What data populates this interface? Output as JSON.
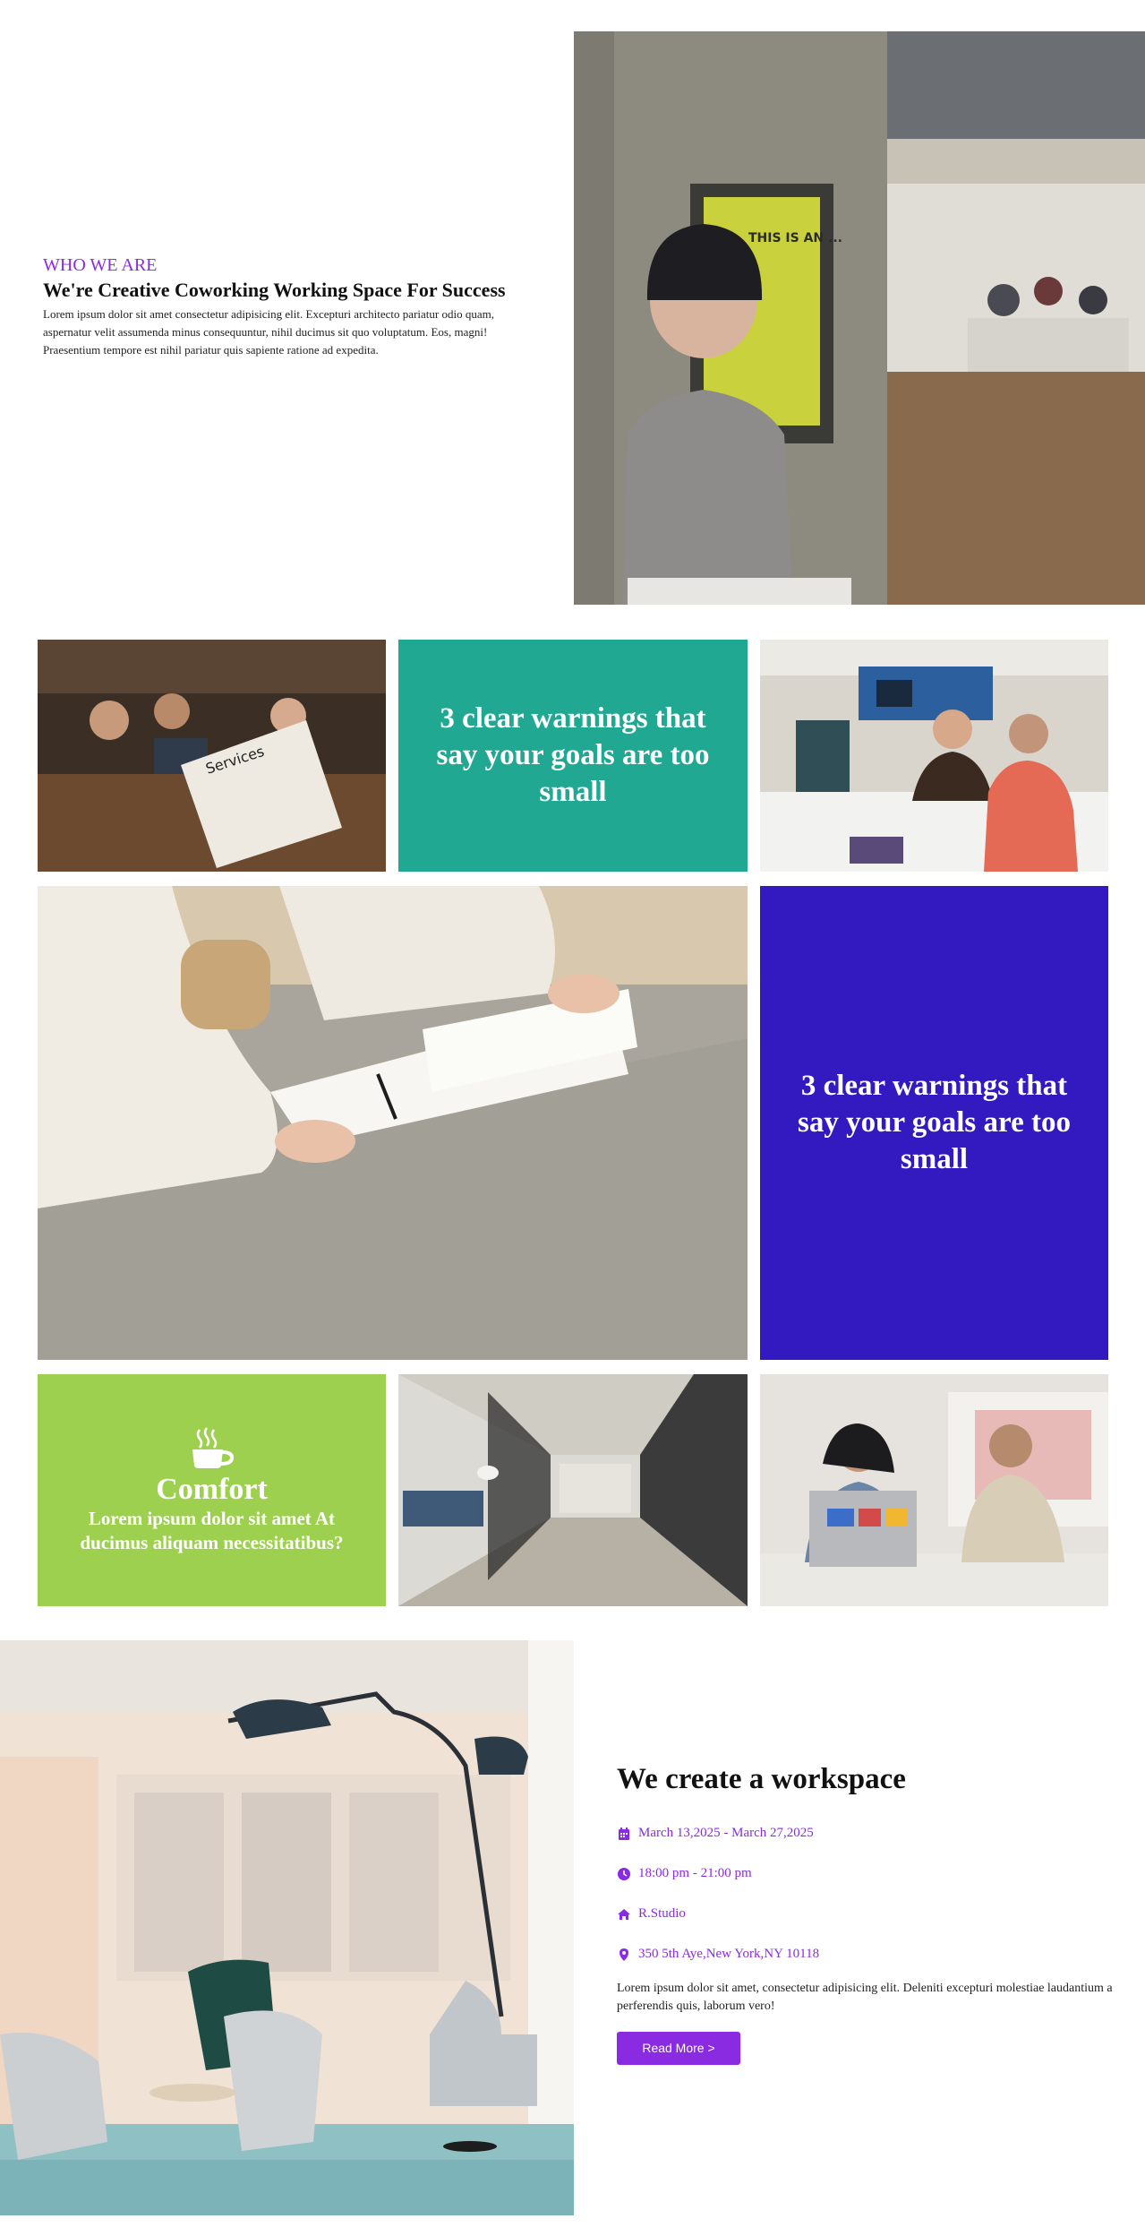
{
  "about": {
    "eyebrow": "WHO WE ARE",
    "title": "We're Creative Coworking Working Space For Success",
    "body": "Lorem ipsum dolor sit amet consectetur adipisicing elit. Excepturi architecto pariatur odio quam, aspernatur velit assumenda minus consequuntur, nihil ducimus sit quo voluptatum. Eos, magni! Praesentium tempore est nihil pariatur quis sapiente ratione ad expedita.",
    "poster_text": "THIS IS AN ..."
  },
  "grid": {
    "warning_teal": "3 clear warnings that say your goals are too small",
    "warning_blue": "3 clear warnings that say your goals are too small",
    "comfort_title": "Comfort",
    "comfort_sub": "Lorem ipsum dolor sit amet At ducimus aliquam necessitatibus?",
    "book_text": "Services"
  },
  "workspace": {
    "title": "We create a workspace",
    "date": "March 13,2025 - March 27,2025",
    "time": "18:00 pm - 21:00 pm",
    "venue": "R.Studio",
    "address": "350 5th Aye,New York,NY 10118",
    "body": "Lorem ipsum dolor sit amet, consectetur adipisicing elit. Deleniti excepturi molestiae laudantium a perferendis quis, laborum vero!",
    "button": "Read More >"
  },
  "colors": {
    "accent": "#8a2be2",
    "teal": "#20a892",
    "indigo": "#3319c0",
    "green": "#9ed050"
  },
  "icons": [
    "calendar-icon",
    "clock-icon",
    "home-icon",
    "map-pin-icon",
    "coffee-cup-icon"
  ]
}
